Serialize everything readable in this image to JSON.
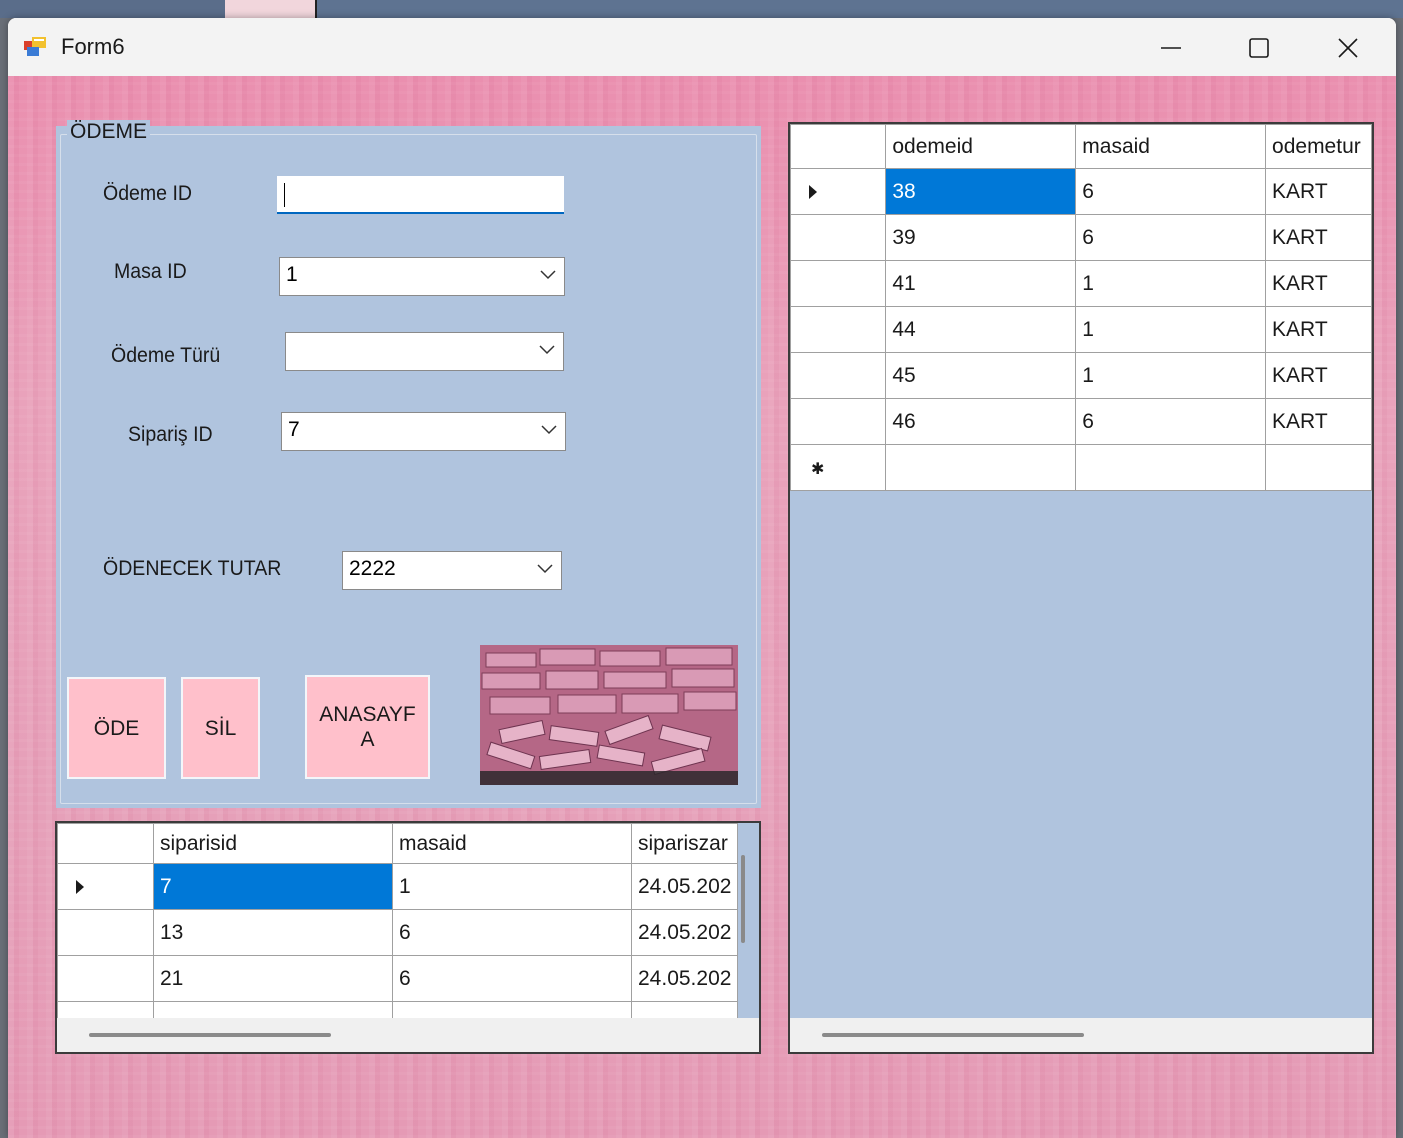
{
  "window": {
    "title": "Form6",
    "controls": {
      "minimize": "minimize-icon",
      "maximize": "maximize-icon",
      "close": "close-icon"
    }
  },
  "form": {
    "group_title": "ÖDEME",
    "fields": {
      "odeme_id": {
        "label": "Ödeme ID",
        "value": ""
      },
      "masa_id": {
        "label": "Masa ID",
        "value": "1"
      },
      "odeme_turu": {
        "label": "Ödeme Türü",
        "value": ""
      },
      "siparis_id": {
        "label": "Sipariş ID",
        "value": "7"
      },
      "odenecek_tutar": {
        "label": "ÖDENECEK TUTAR",
        "value": "2222"
      }
    },
    "buttons": {
      "ode": "ÖDE",
      "sil": "SİL",
      "anasayfa": "ANASAYF\nA"
    },
    "image": "money-image"
  },
  "siparis_grid": {
    "columns": [
      "siparisid",
      "masaid",
      "sipariszar"
    ],
    "rows": [
      {
        "siparisid": "7",
        "masaid": "1",
        "sipariszar": "24.05.202",
        "selected": true
      },
      {
        "siparisid": "13",
        "masaid": "6",
        "sipariszar": "24.05.202",
        "selected": false
      },
      {
        "siparisid": "21",
        "masaid": "6",
        "sipariszar": "24.05.202",
        "selected": false
      }
    ]
  },
  "odeme_grid": {
    "columns": [
      "odemeid",
      "masaid",
      "odemetur"
    ],
    "rows": [
      {
        "odemeid": "38",
        "masaid": "6",
        "odemetur": "KART",
        "selected": true
      },
      {
        "odemeid": "39",
        "masaid": "6",
        "odemetur": "KART",
        "selected": false
      },
      {
        "odemeid": "41",
        "masaid": "1",
        "odemetur": "KART",
        "selected": false
      },
      {
        "odemeid": "44",
        "masaid": "1",
        "odemetur": "KART",
        "selected": false
      },
      {
        "odemeid": "45",
        "masaid": "1",
        "odemetur": "KART",
        "selected": false
      },
      {
        "odemeid": "46",
        "masaid": "6",
        "odemetur": "KART",
        "selected": false
      }
    ]
  },
  "colors": {
    "panel": "#b0c4de",
    "button": "#ffc0cb",
    "selection": "#0078d7",
    "background_pink": "#e89fb8"
  }
}
